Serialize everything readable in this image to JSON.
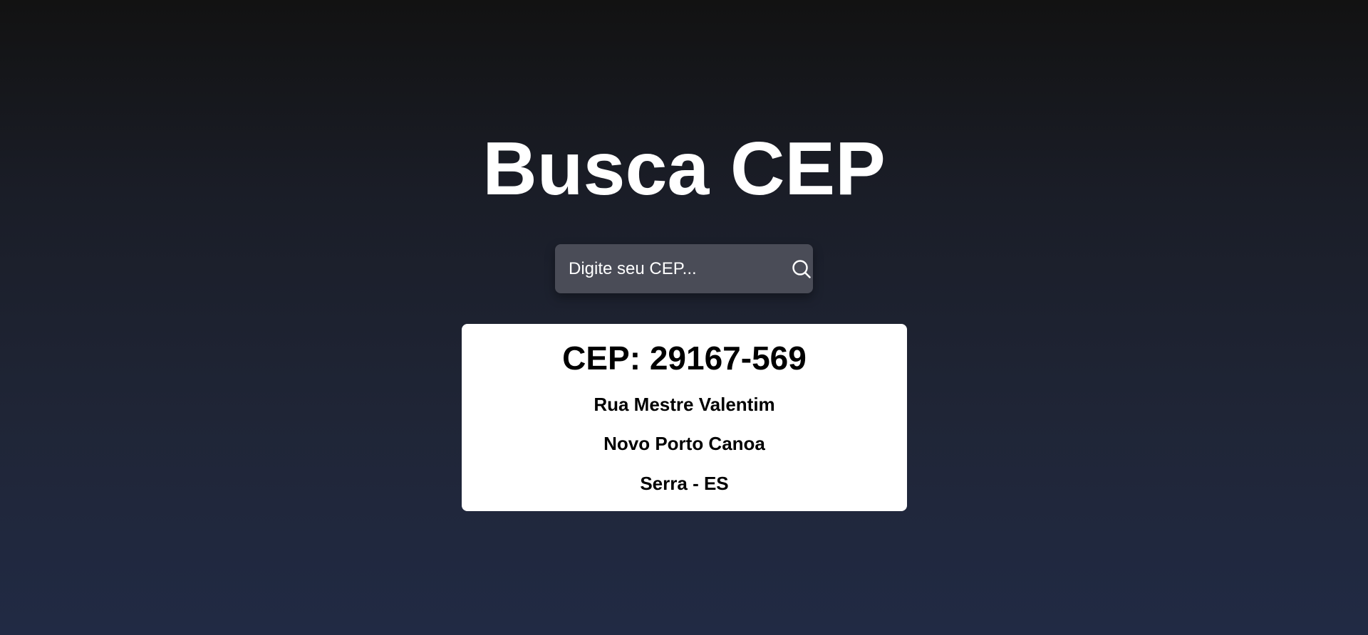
{
  "header": {
    "title": "Busca CEP"
  },
  "search": {
    "placeholder": "Digite seu CEP...",
    "value": "",
    "button_icon": "search-icon"
  },
  "result": {
    "cep_label": "CEP: 29167-569",
    "street": "Rua Mestre Valentim",
    "district": "Novo Porto Canoa",
    "city_state": "Serra - ES"
  },
  "colors": {
    "background_top": "#121212",
    "background_bottom": "#212a44",
    "search_box": "#4a4c57",
    "card": "#ffffff",
    "text_light": "#ffffff",
    "text_dark": "#000000"
  }
}
